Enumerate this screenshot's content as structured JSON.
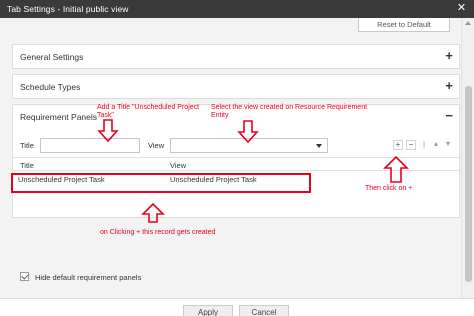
{
  "dialog": {
    "title": "Tab Settings - Initial public view",
    "close_glyph": "✕"
  },
  "reset_button": {
    "label": "Reset to Default"
  },
  "panels": {
    "general": {
      "label": "General Settings",
      "toggle": "+"
    },
    "schedule": {
      "label": "Schedule Types",
      "toggle": "+"
    },
    "requirement": {
      "label": "Requirement Panels",
      "toggle": "−",
      "title_label": "Title",
      "title_value": "",
      "view_label": "View",
      "view_value": "",
      "add_glyph": "+",
      "remove_glyph": "−",
      "separator": "|",
      "up_glyph": "▴",
      "down_glyph": "▾",
      "columns": [
        "Title",
        "View"
      ],
      "rows": [
        {
          "title": "Unscheduled Project Task",
          "view": "Unscheduled Project Task"
        }
      ]
    }
  },
  "hide_default": {
    "label": "Hide default requirement panels",
    "checked": true
  },
  "footer": {
    "apply_label": "Apply",
    "cancel_label": "Cancel"
  },
  "annotations": {
    "add_title": "Add a Title \"Unscheduled Project Task\"",
    "select_view": "Select the view created on Resource Requirement Entity",
    "then_click": "Then click on +",
    "on_clicking": "on Clicking + this record gets created"
  },
  "colors": {
    "annotation": "#e8001c",
    "titlebar": "#3a3a3a"
  }
}
